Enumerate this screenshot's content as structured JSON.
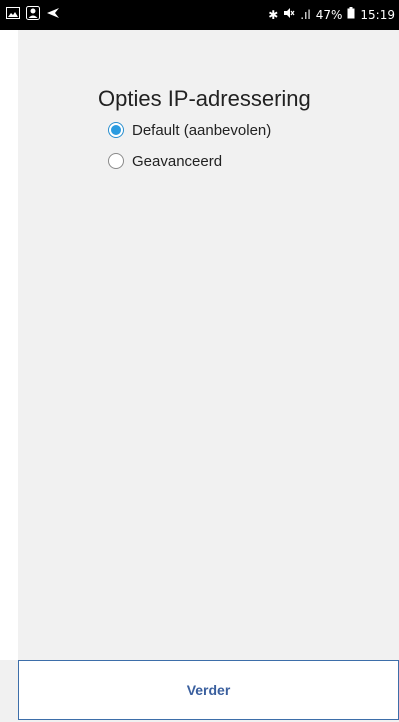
{
  "statusbar": {
    "left_icons": [
      "image-icon",
      "contact-icon",
      "send-icon"
    ],
    "bluetooth_glyph": "✱",
    "mute_glyph": "🔇",
    "signal_glyph": ".ıl",
    "battery": "47%",
    "battery_glyph": "▮",
    "time": "15:19"
  },
  "main": {
    "title": "Opties IP-adressering",
    "options": [
      {
        "label": "Default (aanbevolen)",
        "selected": true
      },
      {
        "label": "Geavanceerd",
        "selected": false
      }
    ]
  },
  "footer": {
    "next_label": "Verder"
  },
  "colors": {
    "accent": "#2a9be0",
    "button_border": "#3d6ea9",
    "button_text": "#3a5f9e",
    "panel_bg": "#f1f1f1"
  }
}
